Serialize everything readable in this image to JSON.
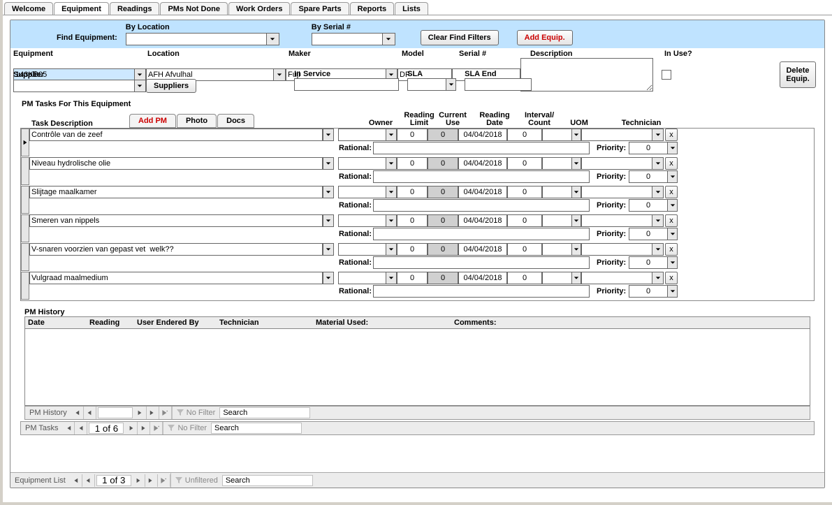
{
  "tabs": {
    "welcome": "Welcome",
    "equipment": "Equipment",
    "readings": "Readings",
    "pms_not_done": "PMs Not Done",
    "work_orders": "Work Orders",
    "spare_parts": "Spare Parts",
    "reports": "Reports",
    "lists": "Lists"
  },
  "find": {
    "label": "Find Equipment:",
    "by_location": "By Location",
    "by_serial": "By Serial #",
    "clear_btn": "Clear Find Filters",
    "add_btn": "Add Equip."
  },
  "hdr": {
    "equipment_lbl": "Equipment",
    "location_lbl": "Location",
    "maker_lbl": "Maker",
    "model_lbl": "Model",
    "serial_lbl": "Serial #",
    "description_lbl": "Description",
    "inuse_lbl": "In Use?",
    "supplier_lbl": "Supplier",
    "suppliers_btn": "Suppliers",
    "inservice_lbl": "In Service",
    "sla_lbl": "SLA",
    "sla_end_lbl": "SLA End",
    "delete_btn": "Delete Equip.",
    "equipment_val": "143KB05",
    "location_val": "AFH Afvulhal",
    "maker_val": "Fuji",
    "model_val": "DF",
    "serial_val": "",
    "inservice_val": "",
    "sla_val": "",
    "sla_end_val": ""
  },
  "pm": {
    "title": "PM Tasks For This Equipment",
    "task_desc_hdr": "Task Description",
    "add_pm": "Add PM",
    "photo": "Photo",
    "docs": "Docs",
    "owner_hdr": "Owner",
    "reading_limit_hdr1": "Reading",
    "reading_limit_hdr2": "Limit",
    "current_use_hdr1": "Current",
    "current_use_hdr2": "Use",
    "reading_date_hdr1": "Reading",
    "reading_date_hdr2": "Date",
    "interval_hdr1": "Interval/",
    "interval_hdr2": "Count",
    "uom_hdr": "UOM",
    "tech_hdr": "Technician",
    "rational_lbl": "Rational:",
    "priority_lbl": "Priority:",
    "x_lbl": "x",
    "tasks": [
      {
        "desc": "Contrôle van de zeef",
        "limit": "0",
        "use": "0",
        "date": "04/04/2018",
        "interval": "0",
        "prio": "0"
      },
      {
        "desc": "Niveau hydrolische olie",
        "limit": "0",
        "use": "0",
        "date": "04/04/2018",
        "interval": "0",
        "prio": "0"
      },
      {
        "desc": "Slijtage maalkamer",
        "limit": "0",
        "use": "0",
        "date": "04/04/2018",
        "interval": "0",
        "prio": "0"
      },
      {
        "desc": "Smeren van nippels",
        "limit": "0",
        "use": "0",
        "date": "04/04/2018",
        "interval": "0",
        "prio": "0"
      },
      {
        "desc": "V-snaren voorzien van gepast vet  welk??",
        "limit": "0",
        "use": "0",
        "date": "04/04/2018",
        "interval": "0",
        "prio": "0"
      },
      {
        "desc": "Vulgraad maalmedium",
        "limit": "0",
        "use": "0",
        "date": "04/04/2018",
        "interval": "0",
        "prio": "0"
      }
    ]
  },
  "hist": {
    "title": "PM History",
    "date": "Date",
    "reading": "Reading",
    "user": "User Endered By",
    "tech": "Technician",
    "material": "Material Used:",
    "comments": "Comments:"
  },
  "nav": {
    "pm_history": "PM History",
    "pm_tasks": "PM Tasks",
    "equipment_list": "Equipment List",
    "no_filter": "No Filter",
    "unfiltered": "Unfiltered",
    "search": "Search",
    "pm_tasks_page": "1 of 6",
    "equip_page": "1 of 3",
    "hist_page": ""
  }
}
